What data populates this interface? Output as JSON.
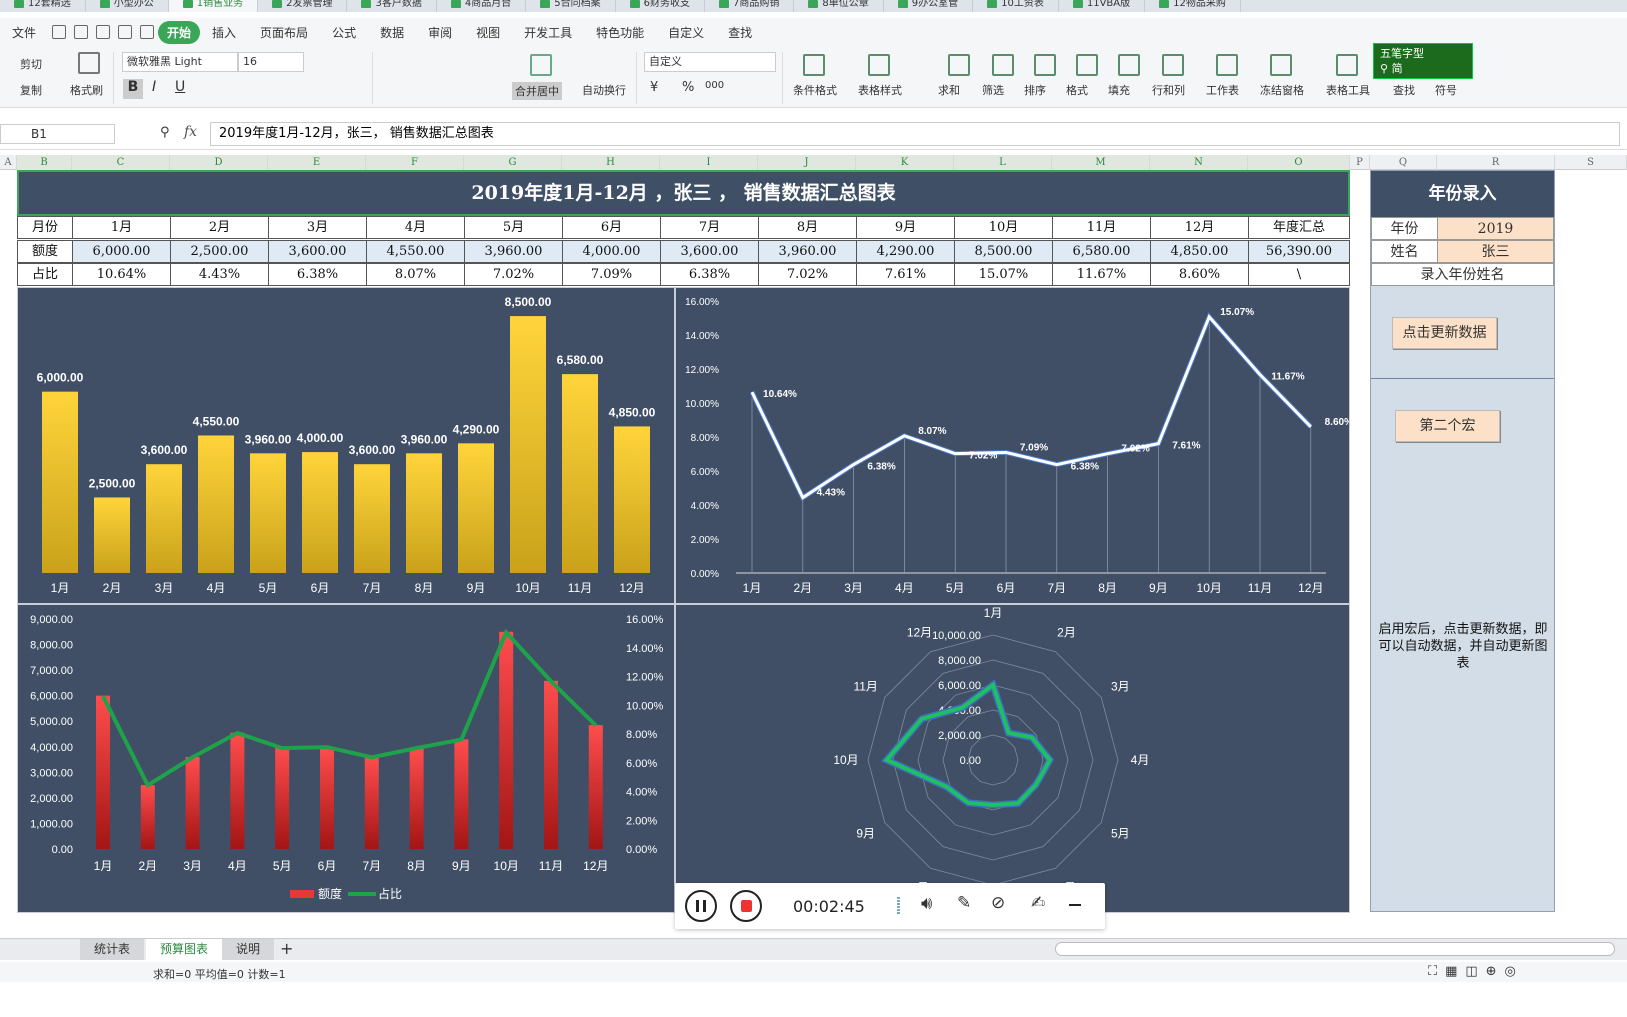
{
  "doc_tabs": [
    "12套精选",
    "小型办公",
    "1销售业务",
    "2发票管理",
    "3客户数据",
    "4商品月台",
    "5合同档案",
    "6财务收支",
    "7商品购销",
    "8单位公章",
    "9办公室管",
    "10工资表",
    "11VBA版",
    "12物品采购"
  ],
  "menu": [
    "文件",
    "开始",
    "插入",
    "页面布局",
    "公式",
    "数据",
    "审阅",
    "视图",
    "开发工具",
    "特色功能",
    "自定义",
    "查找"
  ],
  "ribbon": {
    "cut": "剪切",
    "copy": "复制",
    "format_painter": "格式刷",
    "font_name": "微软雅黑 Light",
    "font_size": "16",
    "bold": "B",
    "italic": "I",
    "underline": "U",
    "merge_center": "合并居中",
    "wrap_text": "自动换行",
    "number_format": "自定义",
    "currency": "¥",
    "percent": "%",
    "thousands": "000",
    "cond_format": "条件格式",
    "table_style": "表格样式",
    "sum": "求和",
    "filter": "筛选",
    "sort": "排序",
    "format": "格式",
    "fill": "填充",
    "row_col": "行和列",
    "worksheet": "工作表",
    "freeze": "冻结窗格",
    "table_tools": "表格工具",
    "find": "查找",
    "symbol": "符号"
  },
  "ime": {
    "mode": "五笔字型",
    "simplified": "简"
  },
  "formula_bar": {
    "name_box": "B1",
    "fx": "fx",
    "formula": "2019年度1月-12月，张三， 销售数据汇总图表"
  },
  "columns": [
    "A",
    "B",
    "C",
    "D",
    "E",
    "F",
    "G",
    "H",
    "I",
    "J",
    "K",
    "L",
    "M",
    "N",
    "O",
    "P",
    "Q",
    "R",
    "S"
  ],
  "sheet": {
    "title": "2019年度1月-12月 ，张三 ， 销售数据汇总图表",
    "row_labels": [
      "月份",
      "额度",
      "占比"
    ],
    "months": [
      "1月",
      "2月",
      "3月",
      "4月",
      "5月",
      "6月",
      "7月",
      "8月",
      "9月",
      "10月",
      "11月",
      "12月"
    ],
    "total_header": "年度汇总",
    "amounts": [
      "6,000.00",
      "2,500.00",
      "3,600.00",
      "4,550.00",
      "3,960.00",
      "4,000.00",
      "3,600.00",
      "3,960.00",
      "4,290.00",
      "8,500.00",
      "6,580.00",
      "4,850.00"
    ],
    "total_amount": "56,390.00",
    "ratios": [
      "10.64%",
      "4.43%",
      "6.38%",
      "8.07%",
      "7.02%",
      "7.09%",
      "6.38%",
      "7.02%",
      "7.61%",
      "15.07%",
      "11.67%",
      "8.60%"
    ],
    "total_ratio": "\\"
  },
  "right_panel": {
    "title": "年份录入",
    "year_label": "年份",
    "year": "2019",
    "name_label": "姓名",
    "name": "张三",
    "hint": "录入年份姓名",
    "update_button": "点击更新数据",
    "macro2_button": "第二个宏",
    "note": "启用宏后，点击更新数据，即可以自动数据，并自动更新图表"
  },
  "chart_data": [
    {
      "type": "bar",
      "categories": [
        "1月",
        "2月",
        "3月",
        "4月",
        "5月",
        "6月",
        "7月",
        "8月",
        "9月",
        "10月",
        "11月",
        "12月"
      ],
      "values": [
        6000,
        2500,
        3600,
        4550,
        3960,
        4000,
        3600,
        3960,
        4290,
        8500,
        6580,
        4850
      ],
      "data_labels": [
        "6,000.00",
        "2,500.00",
        "3,600.00",
        "4,550.00",
        "3,960.00",
        "4,000.00",
        "3,600.00",
        "3,960.00",
        "4,290.00",
        "8,500.00",
        "6,580.00",
        "4,850.00"
      ],
      "ylim": [
        0,
        9000
      ],
      "color": "#f5c518"
    },
    {
      "type": "line",
      "categories": [
        "1月",
        "2月",
        "3月",
        "4月",
        "5月",
        "6月",
        "7月",
        "8月",
        "9月",
        "10月",
        "11月",
        "12月"
      ],
      "values": [
        10.64,
        4.43,
        6.38,
        8.07,
        7.02,
        7.09,
        6.38,
        7.02,
        7.61,
        15.07,
        11.67,
        8.6
      ],
      "data_labels": [
        "10.64%",
        "4.43%",
        "6.38%",
        "8.07%",
        "7.02%",
        "7.09%",
        "6.38%",
        "7.02%",
        "7.61%",
        "15.07%",
        "11.67%",
        "8.60%"
      ],
      "yticks": [
        "0.00%",
        "2.00%",
        "4.00%",
        "6.00%",
        "8.00%",
        "10.00%",
        "12.00%",
        "14.00%",
        "16.00%"
      ],
      "ylim": [
        0,
        16
      ],
      "color": "#ffffff"
    },
    {
      "type": "bar+line",
      "categories": [
        "1月",
        "2月",
        "3月",
        "4月",
        "5月",
        "6月",
        "7月",
        "8月",
        "9月",
        "10月",
        "11月",
        "12月"
      ],
      "series": [
        {
          "name": "额度",
          "type": "bar",
          "values": [
            6000,
            2500,
            3600,
            4550,
            3960,
            4000,
            3600,
            3960,
            4290,
            8500,
            6580,
            4850
          ],
          "color": "#e53935"
        },
        {
          "name": "占比",
          "type": "line",
          "axis": "right",
          "values": [
            10.64,
            4.43,
            6.38,
            8.07,
            7.02,
            7.09,
            6.38,
            7.02,
            7.61,
            15.07,
            11.67,
            8.6
          ],
          "color": "#1fa34a"
        }
      ],
      "yticks_left": [
        "0.00",
        "1,000.00",
        "2,000.00",
        "3,000.00",
        "4,000.00",
        "5,000.00",
        "6,000.00",
        "7,000.00",
        "8,000.00",
        "9,000.00"
      ],
      "yticks_right": [
        "0.00%",
        "2.00%",
        "4.00%",
        "6.00%",
        "8.00%",
        "10.00%",
        "12.00%",
        "14.00%",
        "16.00%"
      ],
      "ylim_left": [
        0,
        9000
      ],
      "ylim_right": [
        0,
        16
      ],
      "legend": "bottom"
    },
    {
      "type": "radar",
      "categories": [
        "1月",
        "2月",
        "3月",
        "4月",
        "5月",
        "6月",
        "7月",
        "8月",
        "9月",
        "10月",
        "11月",
        "12月"
      ],
      "values": [
        6000,
        2500,
        3600,
        4550,
        3960,
        4000,
        3600,
        3960,
        4290,
        8500,
        6580,
        4850
      ],
      "rticks": [
        "0.00",
        "2,000.00",
        "4,000.00",
        "6,000.00",
        "8,000.00",
        "10,000.00"
      ],
      "rlim": [
        0,
        10000
      ],
      "color": "#1fc060"
    }
  ],
  "recorder": {
    "time": "00:02:45"
  },
  "sheet_tabs": [
    "统计表",
    "预算图表",
    "说明"
  ],
  "active_sheet": "预算图表",
  "status": "求和=0  平均值=0  计数=1"
}
